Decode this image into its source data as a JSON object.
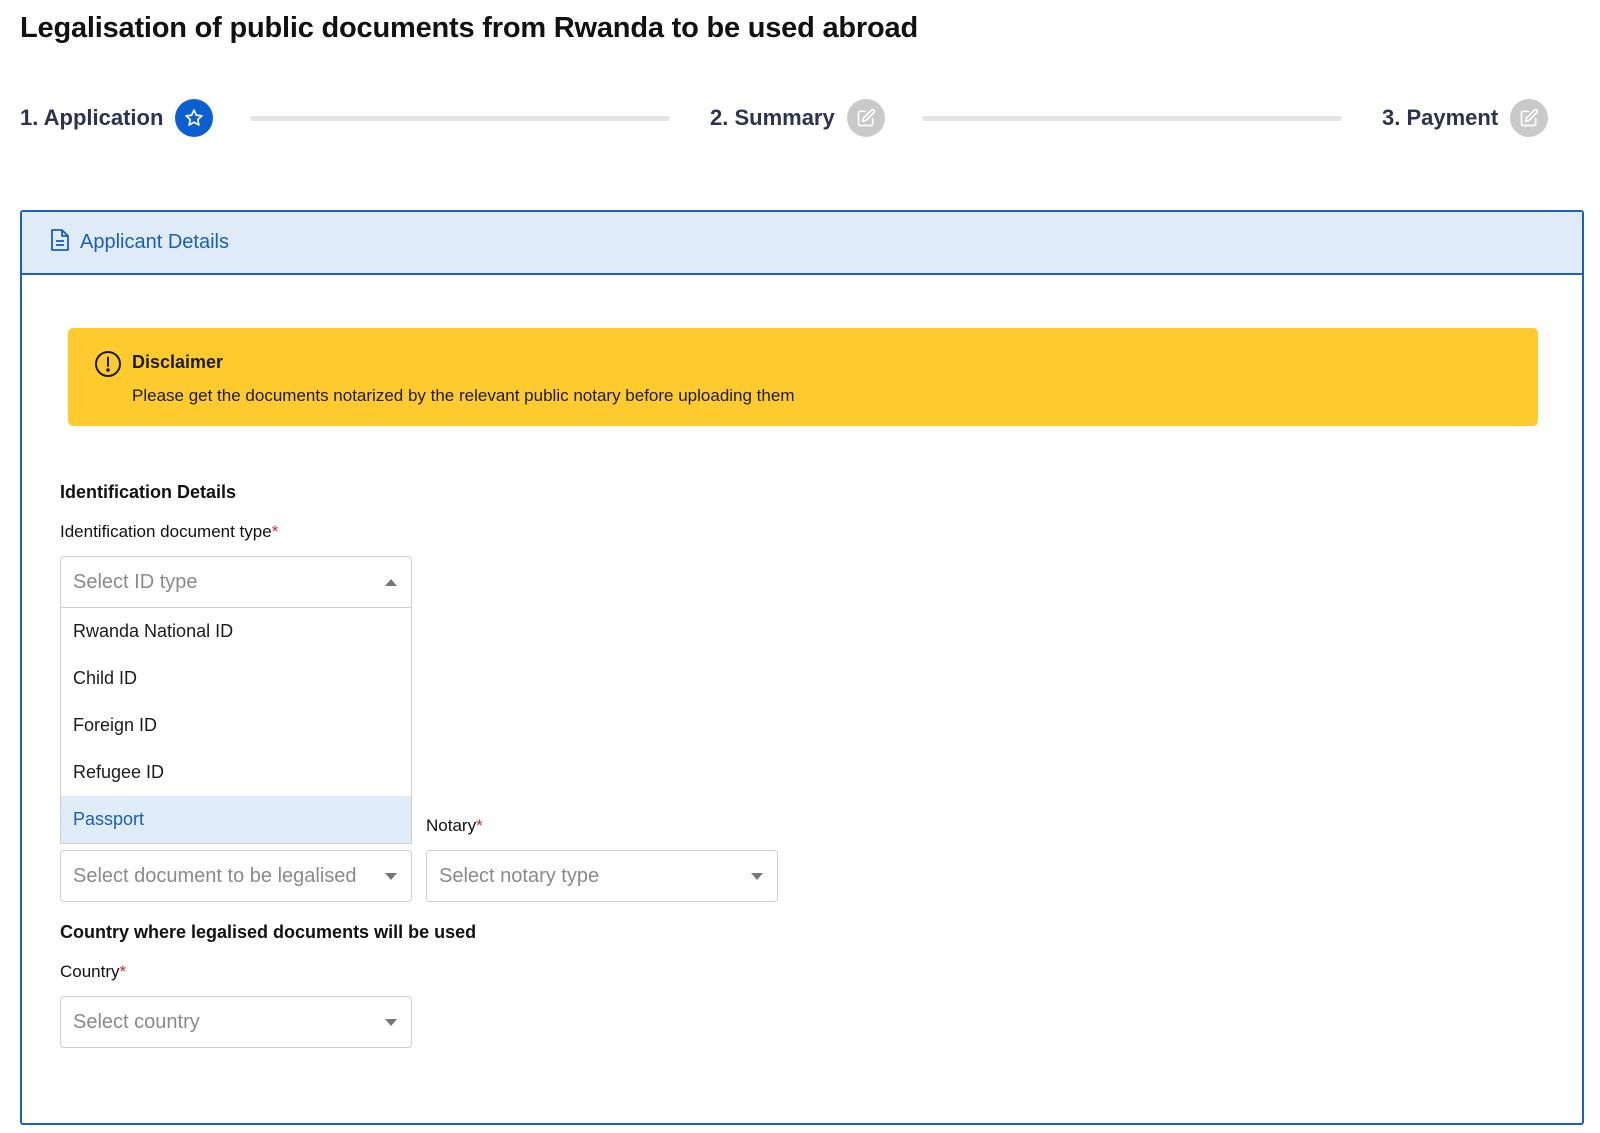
{
  "page": {
    "title": "Legalisation of public documents from Rwanda to be used abroad"
  },
  "stepper": {
    "steps": [
      {
        "label": "1. Application",
        "state": "active",
        "icon": "star-icon"
      },
      {
        "label": "2. Summary",
        "state": "inactive",
        "icon": "edit-icon"
      },
      {
        "label": "3. Payment",
        "state": "inactive",
        "icon": "edit-icon"
      }
    ]
  },
  "panel": {
    "title": "Applicant Details",
    "icon": "document-icon"
  },
  "disclaimer": {
    "title": "Disclaimer",
    "text": "Please get the documents notarized by the relevant public notary before uploading them",
    "icon": "exclamation-circle-icon"
  },
  "identification": {
    "section_title": "Identification Details",
    "id_type_label": "Identification document type",
    "id_type_placeholder": "Select ID type",
    "options": [
      "Rwanda National ID",
      "Child ID",
      "Foreign ID",
      "Refugee ID",
      "Passport"
    ],
    "highlighted_option": "Passport"
  },
  "document": {
    "document_placeholder": "Select document to be legalised",
    "notary_label": "Notary",
    "notary_placeholder": "Select notary type"
  },
  "country": {
    "section_title": "Country where legalised documents will be used",
    "label": "Country",
    "placeholder": "Select country"
  },
  "required_marker": "*",
  "colors": {
    "primary": "#0b5fd1",
    "panel_border": "#1f5fbf",
    "panel_header_bg": "#dfecf8",
    "disclaimer_bg": "#fecb2f",
    "required": "#e02020",
    "inactive_badge": "#c9c9c9"
  }
}
